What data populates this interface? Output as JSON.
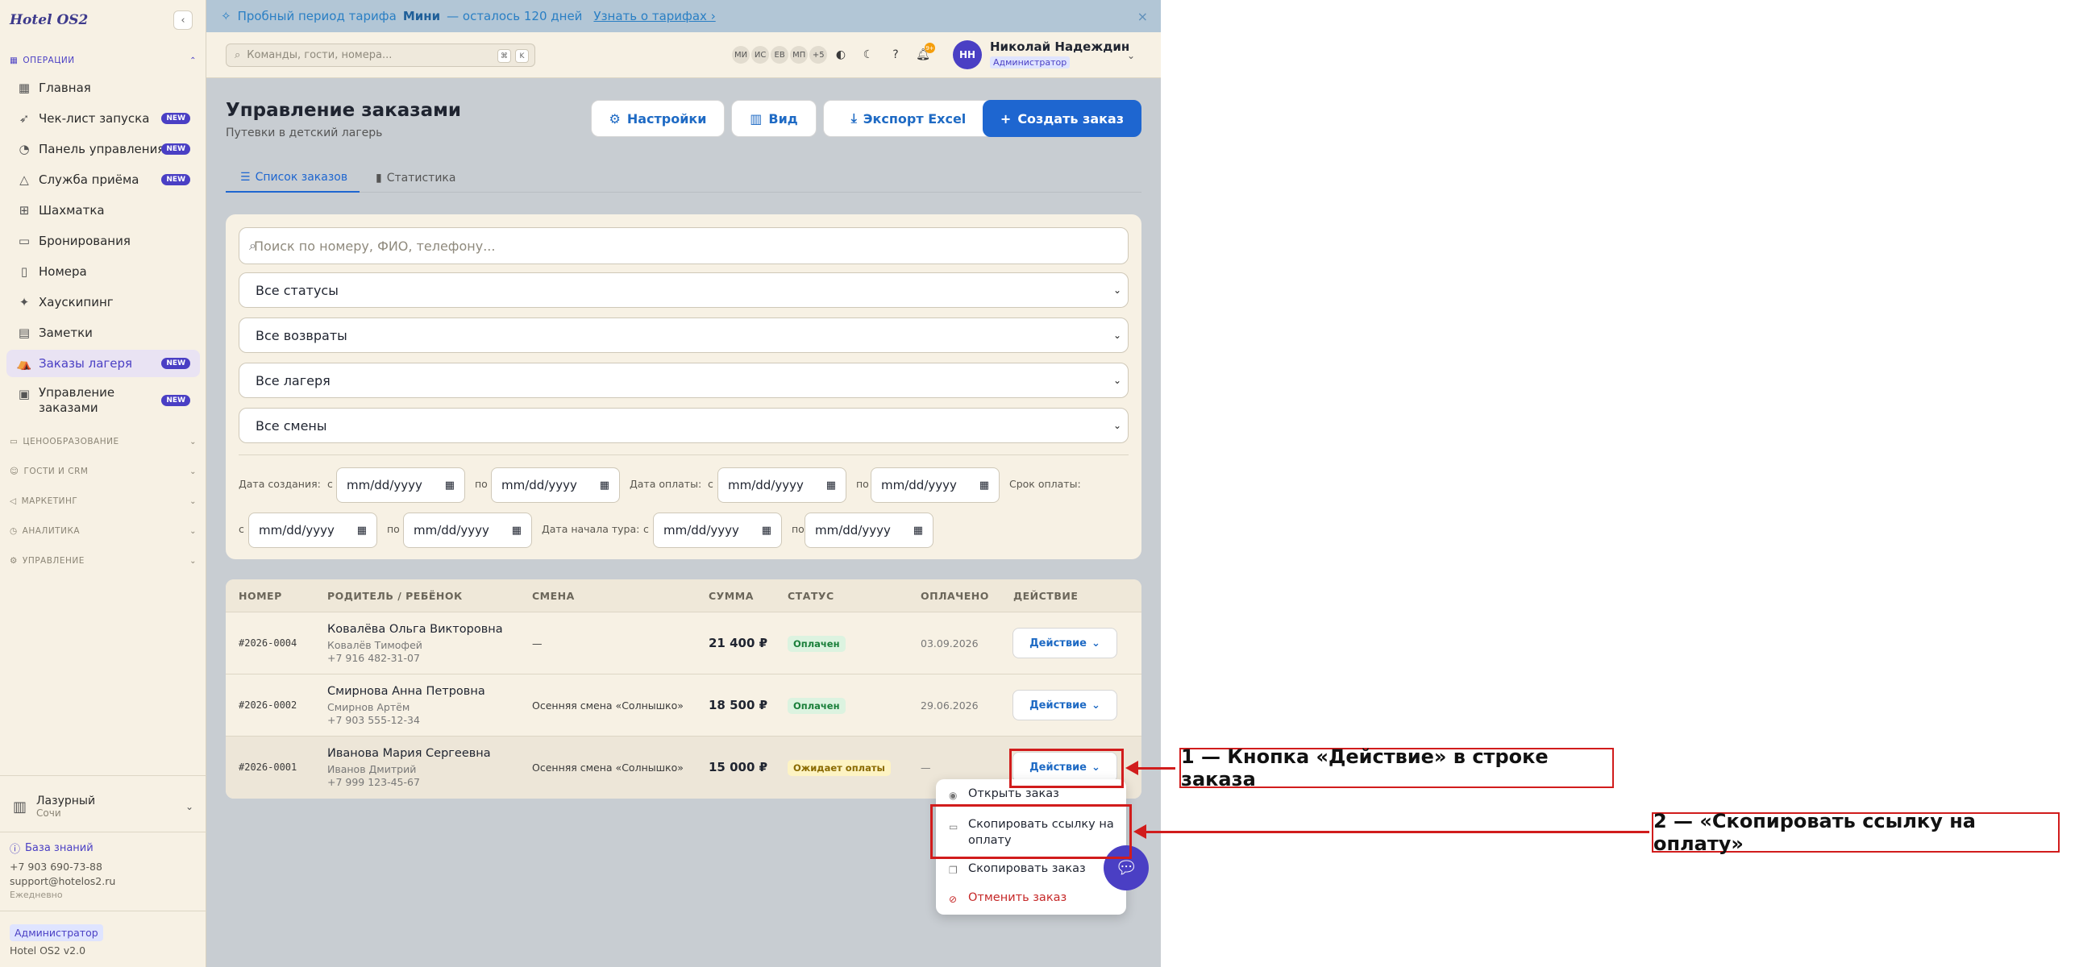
{
  "app": {
    "logo": "Hotel OS2"
  },
  "sidebar": {
    "sections": {
      "operations": "ОПЕРАЦИИ",
      "pricing": "ЦЕНООБРАЗОВАНИЕ",
      "guests": "ГОСТИ И CRM",
      "marketing": "МАРКЕТИНГ",
      "analytics": "АНАЛИТИКА",
      "management": "УПРАВЛЕНИЕ"
    },
    "items": [
      {
        "label": "Главная",
        "icon": "grid-icon"
      },
      {
        "label": "Чек-лист запуска",
        "icon": "rocket-icon",
        "badge": "NEW"
      },
      {
        "label": "Панель управления",
        "icon": "gauge-icon",
        "badge": "NEW"
      },
      {
        "label": "Служба приёма",
        "icon": "bell-desk-icon",
        "badge": "NEW"
      },
      {
        "label": "Шахматка",
        "icon": "table-grid-icon"
      },
      {
        "label": "Бронирования",
        "icon": "clipboard-icon"
      },
      {
        "label": "Номера",
        "icon": "door-icon"
      },
      {
        "label": "Хаускипинг",
        "icon": "sparkle-icon"
      },
      {
        "label": "Заметки",
        "icon": "note-icon"
      },
      {
        "label": "Заказы лагеря",
        "icon": "tent-icon",
        "badge": "NEW",
        "active": true
      },
      {
        "label": "Управление заказами",
        "label_line1": "Управление",
        "label_line2": "заказами",
        "icon": "receipt-icon",
        "badge": "NEW"
      }
    ],
    "hotel": {
      "name": "Лазурный",
      "city": "Сочи"
    },
    "knowledge_base": "База знаний",
    "phone": "+7 903 690-73-88",
    "email": "support@hotelos2.ru",
    "hours": "Ежедневно",
    "role": "Администратор",
    "version": "Hotel OS2 v2.0"
  },
  "banner": {
    "prefix": "Пробный период тарифа",
    "plan": "Мини",
    "suffix": "— осталось 120 дней",
    "link": "Узнать о тарифах ›",
    "close": "×"
  },
  "topbar": {
    "search_placeholder": "Команды, гости, номера...",
    "kbd1": "⌘",
    "kbd2": "K",
    "avatars": [
      "МИ",
      "ИС",
      "ЕВ",
      "МП",
      "+5"
    ],
    "notif_count": "9+",
    "user_initials": "НН",
    "user_name": "Николай Надеждин",
    "user_role": "Администратор"
  },
  "page": {
    "title": "Управление заказами",
    "subtitle": "Путевки в детский лагерь",
    "buttons": {
      "settings": "Настройки",
      "view": "Вид",
      "export": "Экспорт Excel",
      "create": "Создать заказ"
    },
    "tabs": {
      "list": "Список заказов",
      "stats": "Статистика"
    }
  },
  "filters": {
    "search_placeholder": "Поиск по номеру, ФИО, телефону...",
    "status": "Все статусы",
    "refunds": "Все возвраты",
    "camps": "Все лагеря",
    "shifts": "Все смены",
    "created_label": "Дата создания:",
    "paid_label": "Дата оплаты:",
    "due_label": "Срок оплаты:",
    "tour_label": "Дата начала тура:",
    "from": "с",
    "to": "по",
    "date_placeholder": "mm/dd/yyyy"
  },
  "table": {
    "headers": [
      "НОМЕР",
      "РОДИТЕЛЬ / РЕБЁНОК",
      "СМЕНА",
      "СУММА",
      "СТАТУС",
      "ОПЛАЧЕНО",
      "ДЕЙСТВИЕ"
    ],
    "rows": [
      {
        "number": "#2026-0004",
        "parent": "Ковалёва Ольга Викторовна",
        "child": "Ковалёв Тимофей",
        "phone": "+7 916 482-31-07",
        "shift": "—",
        "sum": "21 400 ₽",
        "status": "Оплачен",
        "paid": "03.09.2026",
        "action": "Действие"
      },
      {
        "number": "#2026-0002",
        "parent": "Смирнова Анна Петровна",
        "child": "Смирнов Артём",
        "phone": "+7 903 555-12-34",
        "shift": "Осенняя смена «Солнышко»",
        "sum": "18 500 ₽",
        "status": "Оплачен",
        "paid": "29.06.2026",
        "action": "Действие"
      },
      {
        "number": "#2026-0001",
        "parent": "Иванова Мария Сергеевна",
        "child": "Иванов Дмитрий",
        "phone": "+7 999 123-45-67",
        "shift": "Осенняя смена «Солнышко»",
        "sum": "15 000 ₽",
        "status": "Ожидает оплаты",
        "paid": "—",
        "action": "Действие"
      }
    ]
  },
  "action_menu": {
    "open": "Открыть заказ",
    "copy_link_line1": "Скопировать ссылку на",
    "copy_link_line2": "оплату",
    "copy": "Скопировать заказ",
    "cancel": "Отменить заказ"
  },
  "annotations": {
    "one": "1 — Кнопка «Действие» в строке заказа",
    "two": "2 — «Скопировать ссылку на оплату»"
  },
  "colors": {
    "accent": "#4a3fc4",
    "primary": "#1e66d0",
    "annotation": "#d11c1c"
  }
}
